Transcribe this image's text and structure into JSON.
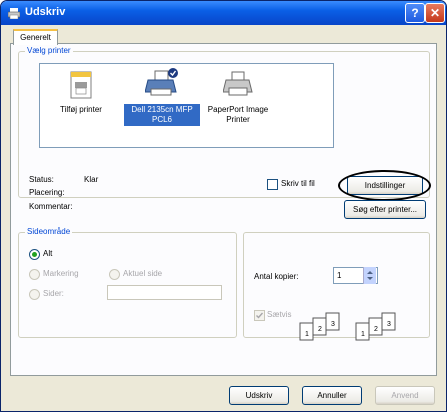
{
  "window": {
    "title": "Udskriv"
  },
  "tabs": [
    "Generelt"
  ],
  "printer_group": {
    "label": "Vælg printer",
    "printers": [
      {
        "name": "Tilføj printer",
        "selected": false,
        "icon": "add-printer-icon"
      },
      {
        "name": "Dell 2135cn MFP PCL6",
        "selected": true,
        "icon": "default-printer-icon"
      },
      {
        "name": "PaperPort Image Printer",
        "selected": false,
        "icon": "printer-icon"
      }
    ],
    "status_label": "Status:",
    "status_value": "Klar",
    "location_label": "Placering:",
    "comment_label": "Kommentar:",
    "print_to_file": "Skriv til fil",
    "preferences_button": "Indstillinger",
    "find_printer_button": "Søg efter printer..."
  },
  "range_group": {
    "label": "Sideområde",
    "all": "Alt",
    "selection": "Markering",
    "current_page": "Aktuel side",
    "pages": "Sider:",
    "pages_value": ""
  },
  "copies": {
    "label": "Antal kopier:",
    "value": "1",
    "collate": "Sætvis"
  },
  "buttons": {
    "print": "Udskriv",
    "cancel": "Annuller",
    "apply": "Anvend"
  },
  "colors": {
    "title_bar": "#0a5fe6",
    "group_label": "#0046d5",
    "selection": "#316ac5"
  }
}
